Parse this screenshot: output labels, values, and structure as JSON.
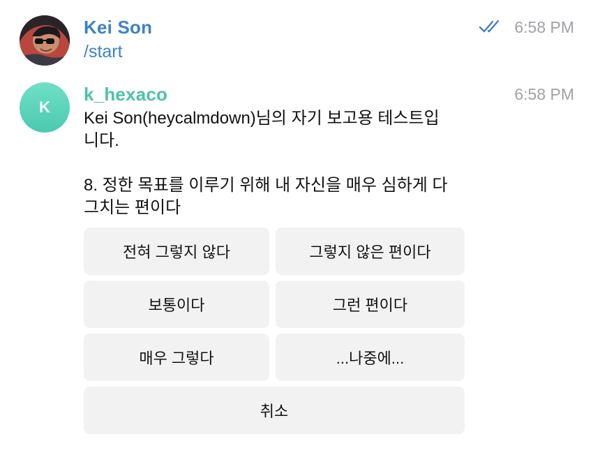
{
  "messages": [
    {
      "sender": "Kei Son",
      "text": "/start",
      "time": "6:58 PM",
      "status_icon": "double-check-icon",
      "avatar": "user-photo"
    },
    {
      "sender": "k_hexaco",
      "avatar_letter": "K",
      "time": "6:58 PM",
      "text_line1": "Kei Son(heycalmdown)님의 자기 보고용 테스트입",
      "text_line2": "니다.",
      "question_line1": "8. 정한 목표를 이루기 위해 내 자신을 매우 심하게 다",
      "question_line2": "그치는 편이다"
    }
  ],
  "keyboard": {
    "buttons": [
      {
        "label": "전혀 그렇지 않다"
      },
      {
        "label": "그렇지 않은 편이다"
      },
      {
        "label": "보통이다"
      },
      {
        "label": "그런 편이다"
      },
      {
        "label": "매우 그렇다"
      },
      {
        "label": "...나중에..."
      },
      {
        "label": "취소"
      }
    ]
  },
  "colors": {
    "accent_blue": "#3e82c6",
    "bot_green": "#4cc3a7",
    "time_gray": "#a1a1a6",
    "button_bg": "#f2f2f3"
  }
}
